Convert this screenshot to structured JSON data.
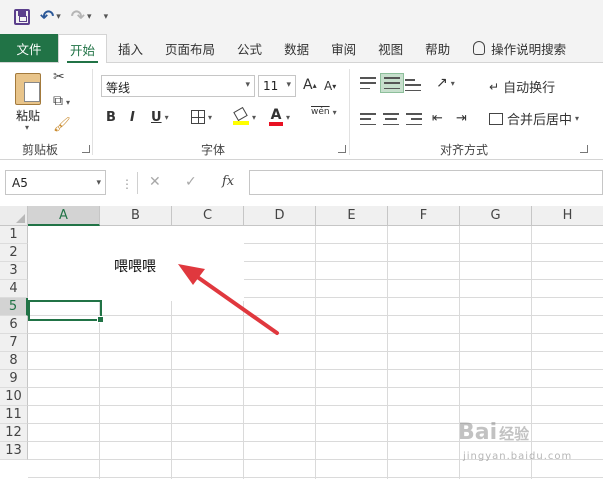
{
  "qat": {
    "redo_title": "",
    "customize": "▾"
  },
  "tabs": [
    {
      "label": "文件"
    },
    {
      "label": "开始"
    },
    {
      "label": "插入"
    },
    {
      "label": "页面布局"
    },
    {
      "label": "公式"
    },
    {
      "label": "数据"
    },
    {
      "label": "审阅"
    },
    {
      "label": "视图"
    },
    {
      "label": "帮助"
    }
  ],
  "tell_me": "操作说明搜索",
  "ribbon": {
    "clipboard": {
      "paste": "粘贴",
      "group": "剪贴板"
    },
    "font": {
      "name": "等线",
      "size": "11",
      "bold": "B",
      "italic": "I",
      "underline": "U",
      "font_color": "A",
      "wen": "wén",
      "grow": "A",
      "shrink": "A",
      "group": "字体"
    },
    "alignment": {
      "wrap": "自动换行",
      "merge": "合并后居中",
      "group": "对齐方式"
    }
  },
  "formula_bar": {
    "name_box": "A5",
    "cancel": "✕",
    "enter": "✓",
    "fx": "fx",
    "value": ""
  },
  "grid": {
    "columns": [
      "A",
      "B",
      "C",
      "D",
      "E",
      "F",
      "G",
      "H"
    ],
    "rows": [
      "1",
      "2",
      "3",
      "4",
      "5",
      "6",
      "7",
      "8",
      "9",
      "10",
      "11",
      "12",
      "13"
    ],
    "selected_column": "A",
    "selected_row": "5",
    "cell_text": "喂喂喂"
  },
  "watermark": {
    "brand": "Bai",
    "brand_suffix": "经验",
    "url": "jingyan.baidu.com"
  },
  "colors": {
    "accent": "#217346",
    "arrow": "#e0383e"
  }
}
